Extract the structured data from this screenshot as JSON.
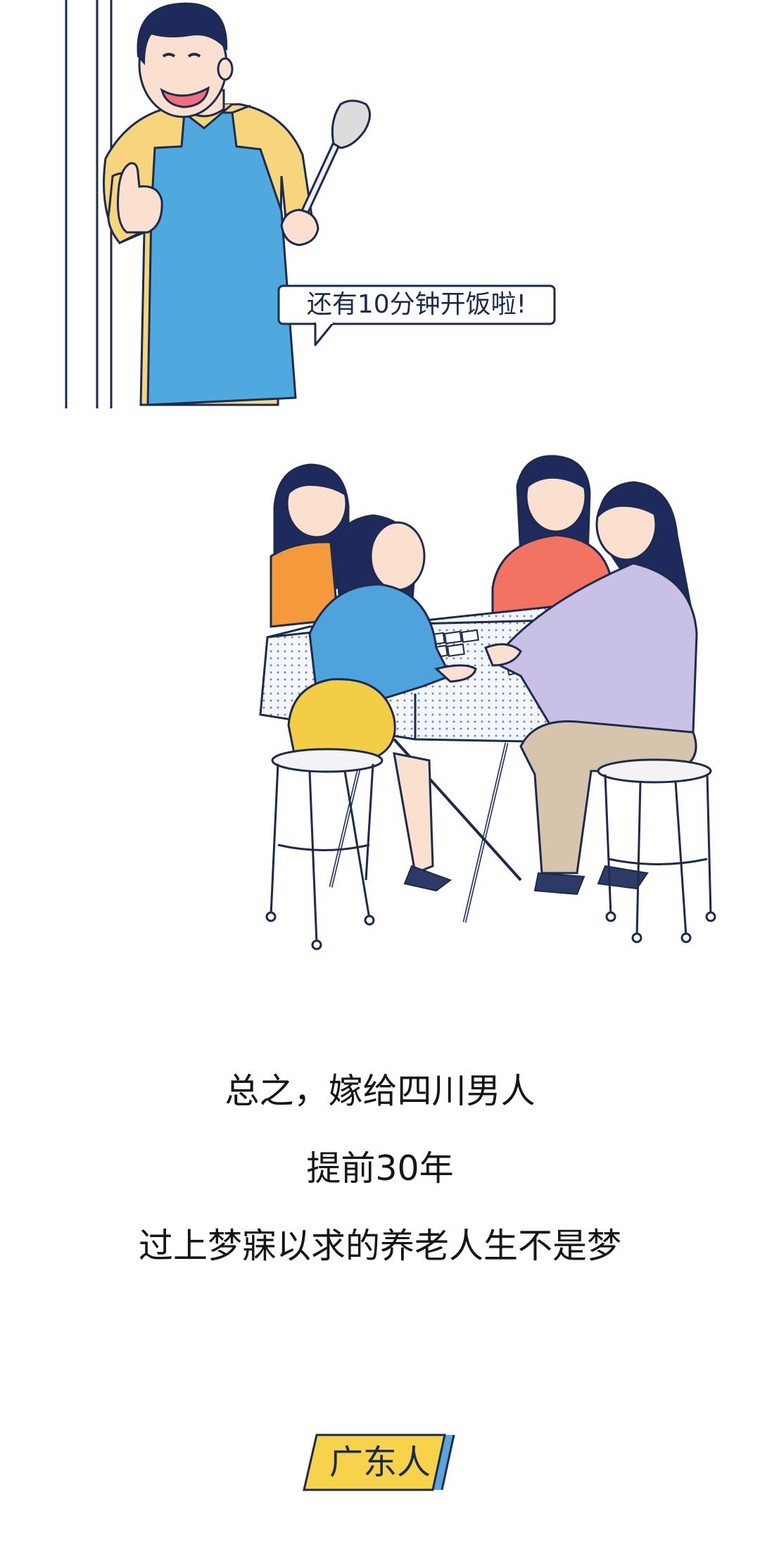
{
  "speech_bubble": {
    "text": "还有10分钟开饭啦!"
  },
  "captions": {
    "line1": "总之，嫁给四川男人",
    "line2": "提前30年",
    "line3": "过上梦寐以求的养老人生不是梦"
  },
  "section_tag": {
    "label": "广东人"
  },
  "colors": {
    "ink": "#1c2a4d",
    "apron_blue": "#4fa9df",
    "shirt_yellow": "#f6d57c",
    "tag_yellow": "#f6d34a",
    "tag_accent_blue": "#5aa5e0",
    "top_orange": "#f59a3c",
    "top_coral": "#f27362",
    "top_blue": "#4fa3dc",
    "top_lilac": "#c9c0e6",
    "skirt_yellow": "#f2cd45",
    "pants_beige": "#d6c4ad",
    "skin": "#fbe0d0",
    "hair": "#1f2a5c"
  },
  "icons": [
    "spatula-icon",
    "thumbs-up-icon",
    "mahjong-tiles-icon",
    "stool-icon"
  ]
}
